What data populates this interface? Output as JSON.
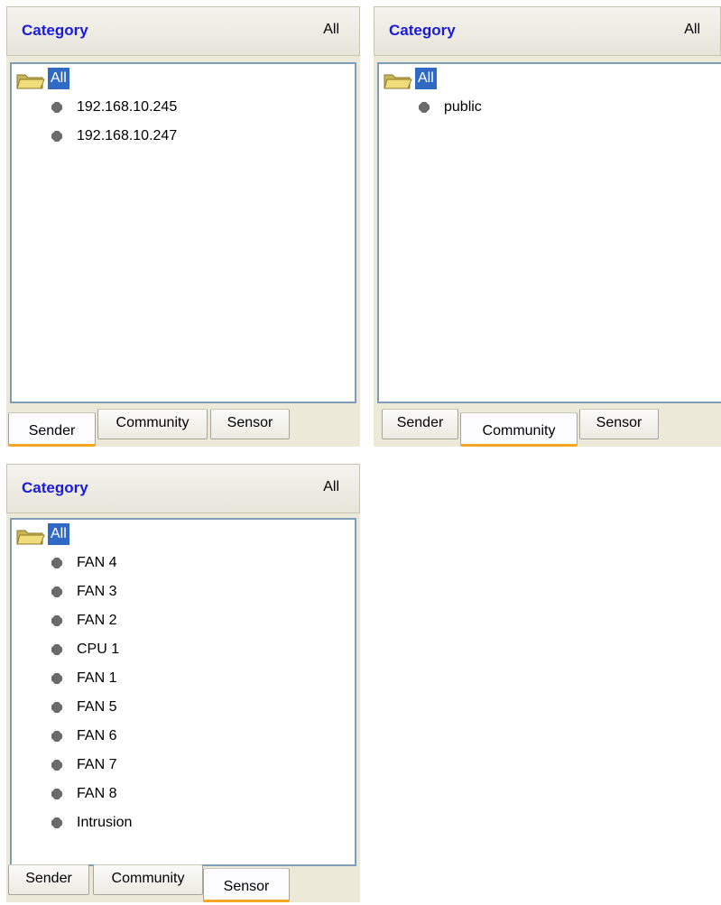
{
  "panels": [
    {
      "header": {
        "title": "Category",
        "filter": "All"
      },
      "tree": {
        "root": "All",
        "items": [
          "192.168.10.245",
          "192.168.10.247"
        ]
      },
      "tabs": [
        "Sender",
        "Community",
        "Sensor"
      ],
      "active_tab": "Sender"
    },
    {
      "header": {
        "title": "Category",
        "filter": "All"
      },
      "tree": {
        "root": "All",
        "items": [
          "public"
        ]
      },
      "tabs": [
        "Sender",
        "Community",
        "Sensor"
      ],
      "active_tab": "Community"
    },
    {
      "header": {
        "title": "Category",
        "filter": "All"
      },
      "tree": {
        "root": "All",
        "items": [
          "FAN 4",
          "FAN 3",
          "FAN 2",
          "CPU 1",
          "FAN 1",
          "FAN 5",
          "FAN 6",
          "FAN 7",
          "FAN 8",
          "Intrusion"
        ]
      },
      "tabs": [
        "Sender",
        "Community",
        "Sensor"
      ],
      "active_tab": "Sensor"
    }
  ],
  "icons": {
    "root": "folder-open-icon",
    "item": "gray-bullet-icon"
  },
  "colors": {
    "title": "#1a1adf",
    "selection": "#316ac5",
    "active_tab_underline": "#f5a623",
    "tree_border": "#7f9db9"
  }
}
